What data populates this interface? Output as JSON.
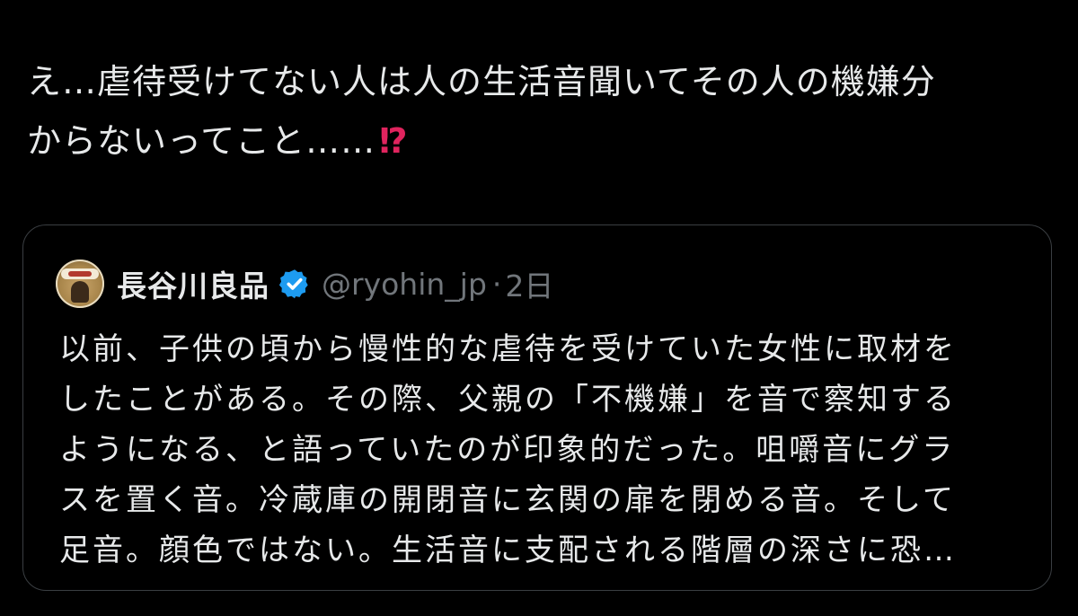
{
  "post": {
    "text_lines": [
      "え…虐待受けてない人は人の生活音聞いてその人の機嫌分",
      "からないってこと……"
    ],
    "emoji": "⁉"
  },
  "quoted_post": {
    "author_name": "長谷川良品",
    "handle": "@ryohin_jp",
    "separator": "·",
    "time": "2日",
    "verified": true,
    "body_lines": [
      "以前、子供の頃から慢性的な虐待を受けていた女性に取材を",
      "したことがある。その際、父親の「不機嫌」を音で察知する",
      "ようになる、と語っていたのが印象的だった。咀嚼音にグラ",
      "スを置く音。冷蔵庫の開閉音に玄関の扉を閉める音。そして",
      "足音。顔色ではない。生活音に支配される階層の深さに恐…"
    ]
  },
  "colors": {
    "background": "#000000",
    "text": "#e7e9ea",
    "muted": "#71767b",
    "border": "#3a3e42",
    "verified": "#1d9bf0",
    "emoji": "#e0245e"
  },
  "icons": {
    "verified": "verified-badge-icon",
    "emoji": "exclamation-question-mark-emoji"
  }
}
